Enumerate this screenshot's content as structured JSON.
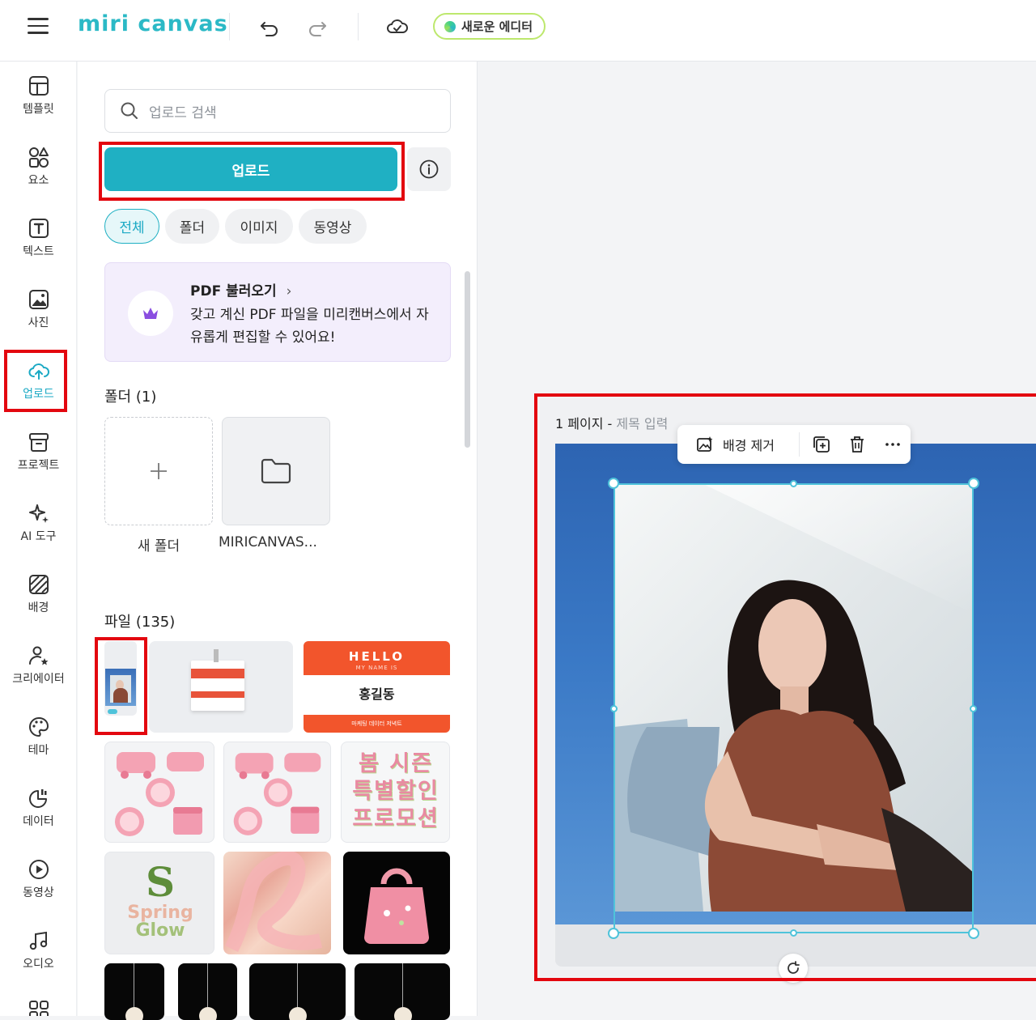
{
  "app": {
    "logo_text": "miri canvas",
    "new_editor_label": "새로운 에디터"
  },
  "sidebar": {
    "items": [
      {
        "label": "템플릿",
        "icon": "template-icon"
      },
      {
        "label": "요소",
        "icon": "elements-icon"
      },
      {
        "label": "텍스트",
        "icon": "text-icon"
      },
      {
        "label": "사진",
        "icon": "photo-icon"
      },
      {
        "label": "업로드",
        "icon": "upload-cloud-icon",
        "active": true
      },
      {
        "label": "프로젝트",
        "icon": "project-box-icon"
      },
      {
        "label": "AI 도구",
        "icon": "ai-sparkle-icon"
      },
      {
        "label": "배경",
        "icon": "background-icon"
      },
      {
        "label": "크리에이터",
        "icon": "creator-icon"
      },
      {
        "label": "테마",
        "icon": "palette-icon"
      },
      {
        "label": "데이터",
        "icon": "chart-icon"
      },
      {
        "label": "동영상",
        "icon": "play-icon"
      },
      {
        "label": "오디오",
        "icon": "music-icon"
      },
      {
        "label": "",
        "icon": "more-apps-icon"
      }
    ]
  },
  "panel": {
    "search_placeholder": "업로드 검색",
    "upload_label": "업로드",
    "filters": [
      "전체",
      "폴더",
      "이미지",
      "동영상"
    ],
    "pdf": {
      "title": "PDF 불러오기",
      "desc": "갖고 계신 PDF 파일을 미리캔버스에서 자유롭게 편집할 수 있어요!"
    },
    "folders_title": "폴더 (1)",
    "new_folder_label": "새 폴더",
    "folder_name": "MIRICANVAS...",
    "files_title": "파일 (135)",
    "files": {
      "hello": "HELLO",
      "my_name_is": "MY NAME IS",
      "name": "홍길동",
      "sub": "마케팅 데이터 저녁트",
      "spring": "Spring",
      "glow": "Glow",
      "promo": "봄 시즌 특별할인 프로모션"
    }
  },
  "canvas": {
    "page_number": "1 페이지",
    "page_title_placeholder": "제목 입력",
    "toolbar": {
      "remove_bg_label": "배경 제거"
    }
  },
  "colors": {
    "accent": "#1fb0c3",
    "highlight": "#e3070f",
    "selection": "#4fc3da"
  }
}
